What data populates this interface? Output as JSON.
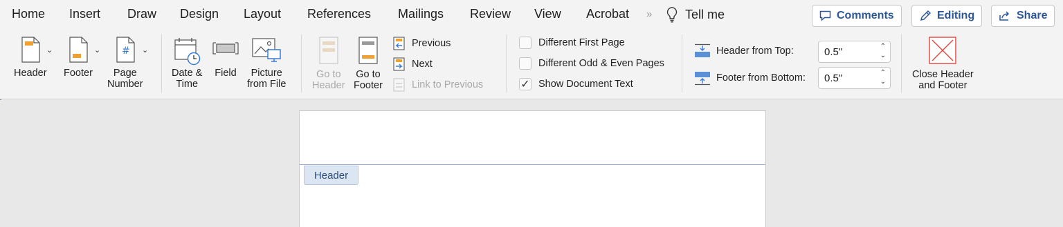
{
  "tabs": [
    {
      "label": "Home"
    },
    {
      "label": "Insert"
    },
    {
      "label": "Draw"
    },
    {
      "label": "Design"
    },
    {
      "label": "Layout"
    },
    {
      "label": "References"
    },
    {
      "label": "Mailings"
    },
    {
      "label": "Review"
    },
    {
      "label": "View"
    },
    {
      "label": "Acrobat"
    }
  ],
  "overflow_glyph": "»",
  "tell_me": "Tell me",
  "topright": {
    "comments": "Comments",
    "editing": "Editing",
    "share": "Share"
  },
  "ribbon": {
    "header": "Header",
    "footer": "Footer",
    "page_number": [
      "Page",
      "Number"
    ],
    "date_time": [
      "Date &",
      "Time"
    ],
    "field": "Field",
    "picture": [
      "Picture",
      "from File"
    ],
    "goto_header": [
      "Go to",
      "Header"
    ],
    "goto_footer": [
      "Go to",
      "Footer"
    ],
    "previous": "Previous",
    "next": "Next",
    "link_prev": "Link to Previous",
    "options": {
      "diff_first": {
        "label": "Different First Page",
        "checked": false
      },
      "diff_odd_even": {
        "label": "Different Odd & Even Pages",
        "checked": false
      },
      "show_text": {
        "label": "Show Document Text",
        "checked": true
      }
    },
    "header_from_top": {
      "label": "Header from Top:",
      "value": "0.5\""
    },
    "footer_from_bottom": {
      "label": "Footer from Bottom:",
      "value": "0.5\""
    },
    "close": [
      "Close Header",
      "and Footer"
    ]
  },
  "document": {
    "header_tag": "Header"
  },
  "colors": {
    "accent": "#2b579a",
    "close_red": "#e0453a",
    "doc_icon_orange": "#f0a030",
    "doc_icon_blue": "#3a7bd5"
  }
}
